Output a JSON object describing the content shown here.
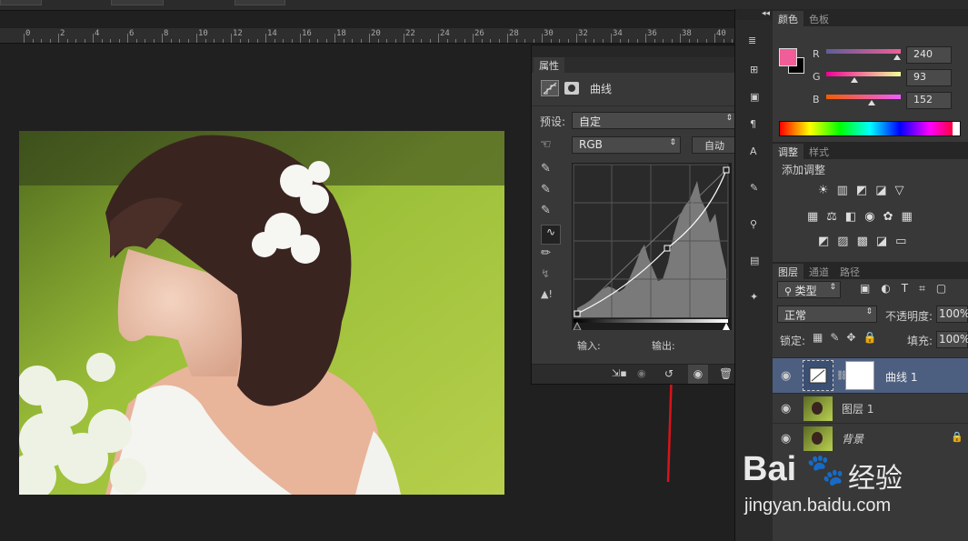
{
  "ruler": {
    "labels": [
      "0",
      "2",
      "4",
      "6",
      "8",
      "10",
      "12",
      "14",
      "16",
      "18",
      "20",
      "22",
      "24",
      "26",
      "28",
      "30",
      "32",
      "34",
      "36",
      "38",
      "40"
    ]
  },
  "properties": {
    "tab": "属性",
    "adjustment_title": "曲线",
    "preset_label": "预设:",
    "preset_value": "自定",
    "channel_value": "RGB",
    "auto_button": "自动",
    "input_label": "输入:",
    "output_label": "输出:"
  },
  "color": {
    "tabs": [
      "颜色",
      "色板"
    ],
    "channels": [
      {
        "label": "R",
        "value": "240",
        "pos": 0.94
      },
      {
        "label": "G",
        "value": "93",
        "pos": 0.36
      },
      {
        "label": "B",
        "value": "152",
        "pos": 0.6
      }
    ],
    "foreground": "#f05d98"
  },
  "adjustments": {
    "tabs": [
      "调整",
      "样式"
    ],
    "title": "添加调整"
  },
  "layers": {
    "tabs": [
      "图层",
      "通道",
      "路径"
    ],
    "filter_kind": "类型",
    "blend_mode": "正常",
    "opacity_label": "不透明度:",
    "opacity_value": "100%",
    "lock_label": "锁定:",
    "fill_label": "填充:",
    "fill_value": "100%",
    "items": [
      {
        "name": "曲线 1",
        "selected": true
      },
      {
        "name": "图层 1",
        "selected": false
      },
      {
        "name": "背景",
        "selected": false
      }
    ]
  },
  "watermark": {
    "brand": "Bai",
    "brand2": "经验",
    "url": "jingyan.baidu.com"
  }
}
